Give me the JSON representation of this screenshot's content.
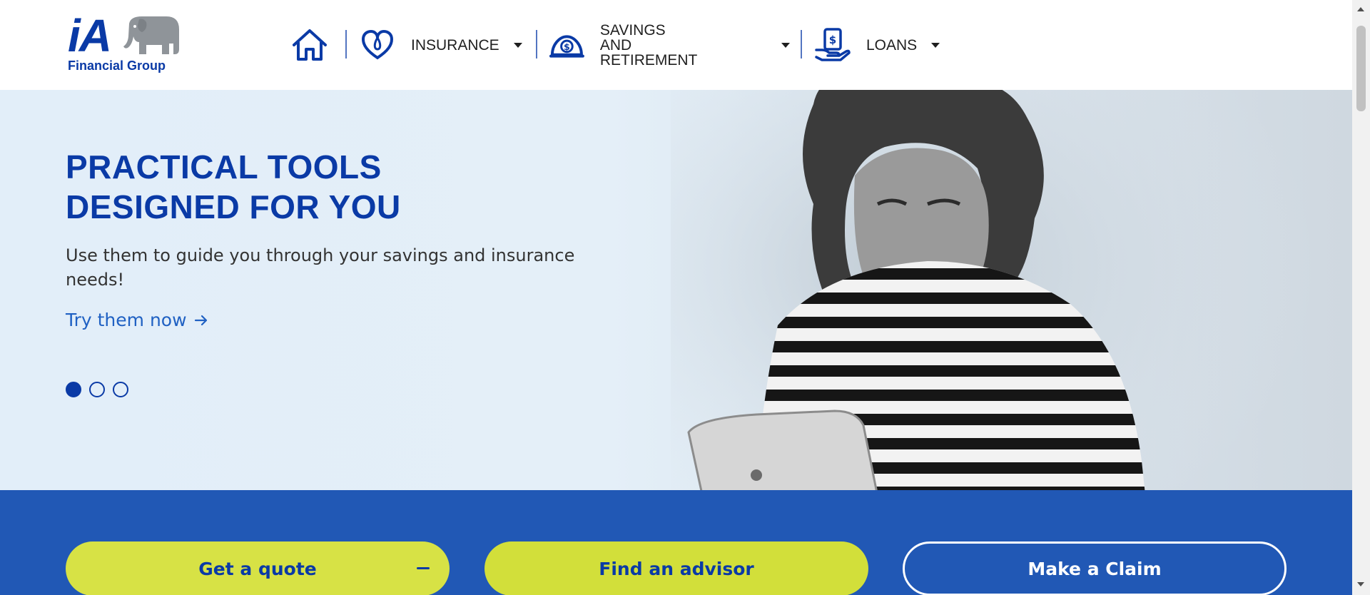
{
  "brand": {
    "logo_text": "iA",
    "group_name": "Financial Group",
    "primary_color": "#0a3aa6",
    "accent_color": "#d7e245",
    "bar_color": "#2158b5"
  },
  "nav": {
    "home_icon": "home-icon",
    "items": [
      {
        "label": "INSURANCE",
        "icon": "heart-icon"
      },
      {
        "label": "SAVINGS AND RETIREMENT",
        "label_line1": "SAVINGS AND",
        "label_line2": "RETIREMENT",
        "icon": "piggy-coin-icon"
      },
      {
        "label": "LOANS",
        "icon": "hand-dollar-icon"
      }
    ]
  },
  "hero": {
    "title_line1": "PRACTICAL TOOLS",
    "title_line2": "DESIGNED FOR YOU",
    "subtitle": "Use them to guide you through your savings and insurance needs!",
    "cta_label": "Try them now",
    "cta_icon": "arrow-right-icon",
    "slides_total": 3,
    "active_slide": 1
  },
  "actions": {
    "quote_label": "Get a quote",
    "advisor_label": "Find an advisor",
    "claim_label": "Make a Claim"
  }
}
